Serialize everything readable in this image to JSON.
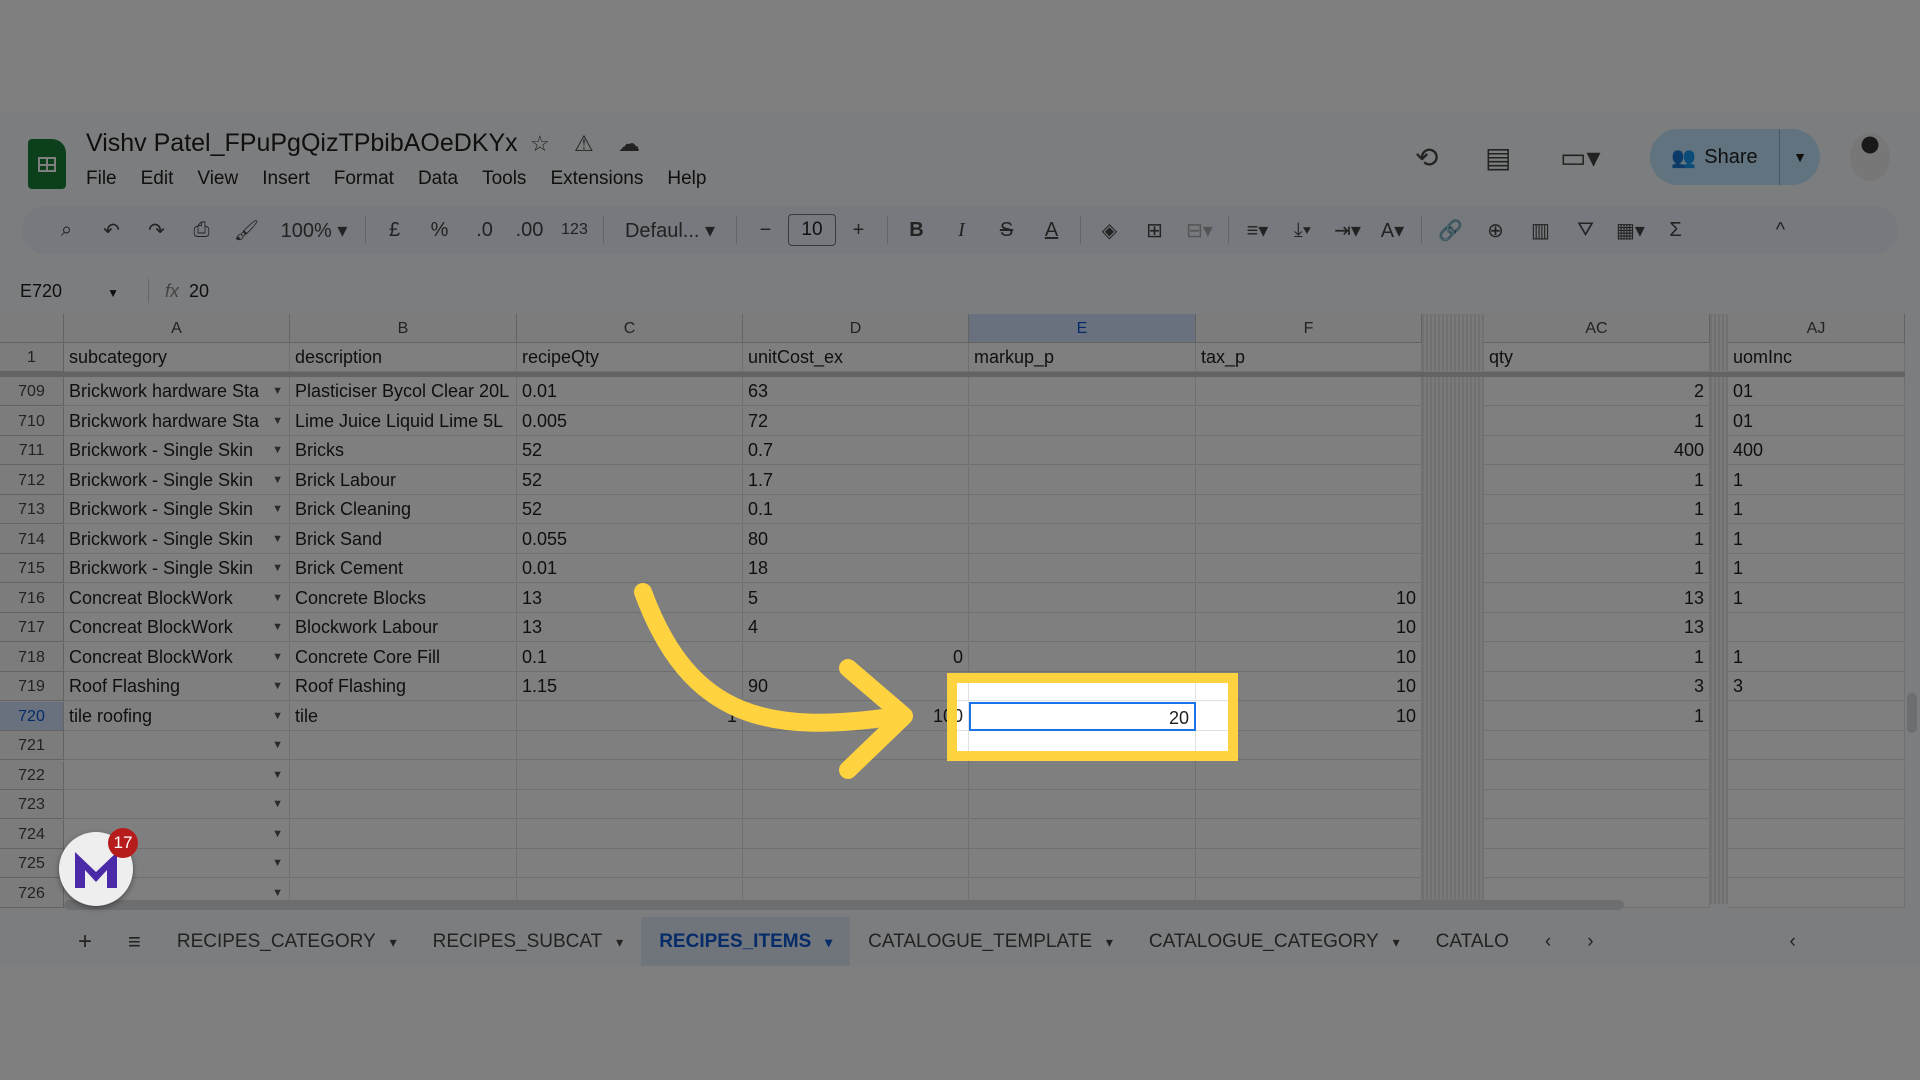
{
  "doc": {
    "title": "Vishv Patel_FPuPgQizTPbibAOeDKYx",
    "menu": [
      "File",
      "Edit",
      "View",
      "Insert",
      "Format",
      "Data",
      "Tools",
      "Extensions",
      "Help"
    ],
    "share_label": "Share"
  },
  "toolbar": {
    "zoom": "100%",
    "currency": "£",
    "percent": "%",
    "dec_decrease": ".0",
    "dec_increase": ".00",
    "format_123": "123",
    "font": "Defaul...",
    "font_size": "10",
    "bold": "B",
    "italic": "I"
  },
  "formula_bar": {
    "cell_ref": "E720",
    "fx": "fx",
    "value": "20"
  },
  "columns": [
    "A",
    "B",
    "C",
    "D",
    "E",
    "F",
    "AC",
    "AJ"
  ],
  "header_row": {
    "row": "1",
    "A": "subcategory",
    "B": "description",
    "C": "recipeQty",
    "D": "unitCost_ex",
    "E": "markup_p",
    "F": "tax_p",
    "AC": "qty",
    "AJ": "uomInc"
  },
  "rows": [
    {
      "row": "709",
      "A": "Brickwork hardware Sta",
      "B": "Plasticiser Bycol Clear 20L",
      "C": "0.01",
      "D": "63",
      "AC": 2,
      "AJ": "01"
    },
    {
      "row": "710",
      "A": "Brickwork hardware Sta",
      "B": "Lime Juice Liquid Lime 5L",
      "C": "0.005",
      "D": "72",
      "AC": 1,
      "AJ": "01"
    },
    {
      "row": "711",
      "A": "Brickwork - Single Skin",
      "B": "Bricks",
      "C": "52",
      "D": "0.7",
      "AC": 400,
      "AJ": "400"
    },
    {
      "row": "712",
      "A": "Brickwork - Single Skin",
      "B": "Brick Labour",
      "C": "52",
      "D": "1.7",
      "AC": 1,
      "AJ": "1"
    },
    {
      "row": "713",
      "A": "Brickwork - Single Skin",
      "B": "Brick Cleaning",
      "C": "52",
      "D": "0.1",
      "AC": 1,
      "AJ": "1"
    },
    {
      "row": "714",
      "A": "Brickwork - Single Skin",
      "B": "Brick Sand",
      "C": "0.055",
      "D": "80",
      "AC": 1,
      "AJ": "1"
    },
    {
      "row": "715",
      "A": "Brickwork - Single Skin",
      "B": "Brick Cement",
      "C": "0.01",
      "D": "18",
      "AC": 1,
      "AJ": "1"
    },
    {
      "row": "716",
      "A": "Concreat BlockWork",
      "B": "Concrete Blocks",
      "C": "13",
      "D": "5",
      "F": 10,
      "AC": 13,
      "AJ": "1"
    },
    {
      "row": "717",
      "A": "Concreat BlockWork",
      "B": "Blockwork Labour",
      "C": "13",
      "D": "4",
      "F": 10,
      "AC": 13
    },
    {
      "row": "718",
      "A": "Concreat BlockWork",
      "B": "Concrete Core Fill",
      "C": "0.1",
      "D": 0,
      "F": 10,
      "AC": 1,
      "AJ": "1"
    },
    {
      "row": "719",
      "A": "Roof Flashing",
      "B": "Roof Flashing",
      "C": "1.15",
      "D": "90",
      "F": 10,
      "AC": 3,
      "AJ": "3"
    },
    {
      "row": "720",
      "A": "tile roofing",
      "B": "tile",
      "C": 1,
      "D": 100,
      "E": 20,
      "F": 10,
      "AC": 1
    },
    {
      "row": "721"
    },
    {
      "row": "722"
    },
    {
      "row": "723"
    },
    {
      "row": "724"
    },
    {
      "row": "725"
    },
    {
      "row": "726"
    }
  ],
  "selected_cell": "E720",
  "sheet_tabs": [
    {
      "label": "RECIPES_CATEGORY"
    },
    {
      "label": "RECIPES_SUBCAT"
    },
    {
      "label": "RECIPES_ITEMS",
      "active": true
    },
    {
      "label": "CATALOGUE_TEMPLATE"
    },
    {
      "label": "CATALOGUE_CATEGORY"
    },
    {
      "label": "CATALO"
    }
  ],
  "notification_badge": "17",
  "colors": {
    "highlight": "#ffd23f",
    "arrow": "#ffd23f",
    "selection": "#1a73e8",
    "active_tab": "#0b57d0",
    "share_bg": "#c2e7ff"
  }
}
